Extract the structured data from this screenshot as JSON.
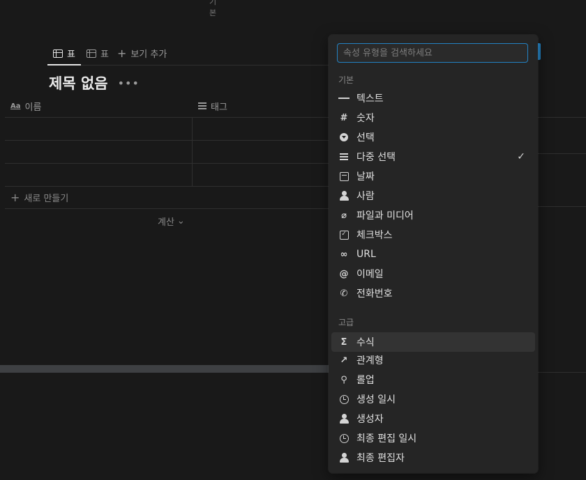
{
  "top_stub": "기본",
  "views": {
    "tabs": [
      {
        "label": "표",
        "icon": "table-icon"
      },
      {
        "label": "표",
        "icon": "table-icon"
      }
    ],
    "add_view": "보기 추가"
  },
  "database": {
    "title": "제목 없음",
    "more": "•••",
    "columns": [
      {
        "label": "이름",
        "icon": "text-property-icon",
        "icon_text": "Aa"
      },
      {
        "label": "태그",
        "icon": "multi-select-icon"
      }
    ],
    "new_row": "새로 만들기",
    "calculate": "계산",
    "calculate_chevron": "⌄"
  },
  "menu": {
    "search_placeholder": "속성 유형을 검색하세요",
    "basic_label": "기본",
    "basic_items": [
      {
        "label": "텍스트",
        "icon": "text-icon"
      },
      {
        "label": "숫자",
        "icon": "number-icon",
        "glyph": "#"
      },
      {
        "label": "선택",
        "icon": "select-icon"
      },
      {
        "label": "다중 선택",
        "icon": "multi-select-icon",
        "checked": true,
        "check": "✓"
      },
      {
        "label": "날짜",
        "icon": "calendar-icon"
      },
      {
        "label": "사람",
        "icon": "people-icon"
      },
      {
        "label": "파일과 미디어",
        "icon": "paperclip-icon",
        "glyph": "⌀"
      },
      {
        "label": "체크박스",
        "icon": "checkbox-icon",
        "glyph": "✓"
      },
      {
        "label": "URL",
        "icon": "link-icon",
        "glyph": "∞"
      },
      {
        "label": "이메일",
        "icon": "at-icon",
        "glyph": "@"
      },
      {
        "label": "전화번호",
        "icon": "phone-icon",
        "glyph": "✆"
      }
    ],
    "advanced_label": "고급",
    "advanced_items": [
      {
        "label": "수식",
        "icon": "formula-icon",
        "glyph": "Σ"
      },
      {
        "label": "관계형",
        "icon": "relation-arrow-icon",
        "glyph": "↗"
      },
      {
        "label": "롤업",
        "icon": "rollup-search-icon",
        "glyph": "⚲"
      },
      {
        "label": "생성 일시",
        "icon": "clock-icon"
      },
      {
        "label": "생성자",
        "icon": "person-icon"
      },
      {
        "label": "최종 편집 일시",
        "icon": "clock-icon"
      },
      {
        "label": "최종 편집자",
        "icon": "person-icon"
      }
    ]
  },
  "colors": {
    "background": "#191919",
    "menu_bg": "#252525",
    "accent": "#2383c4"
  }
}
